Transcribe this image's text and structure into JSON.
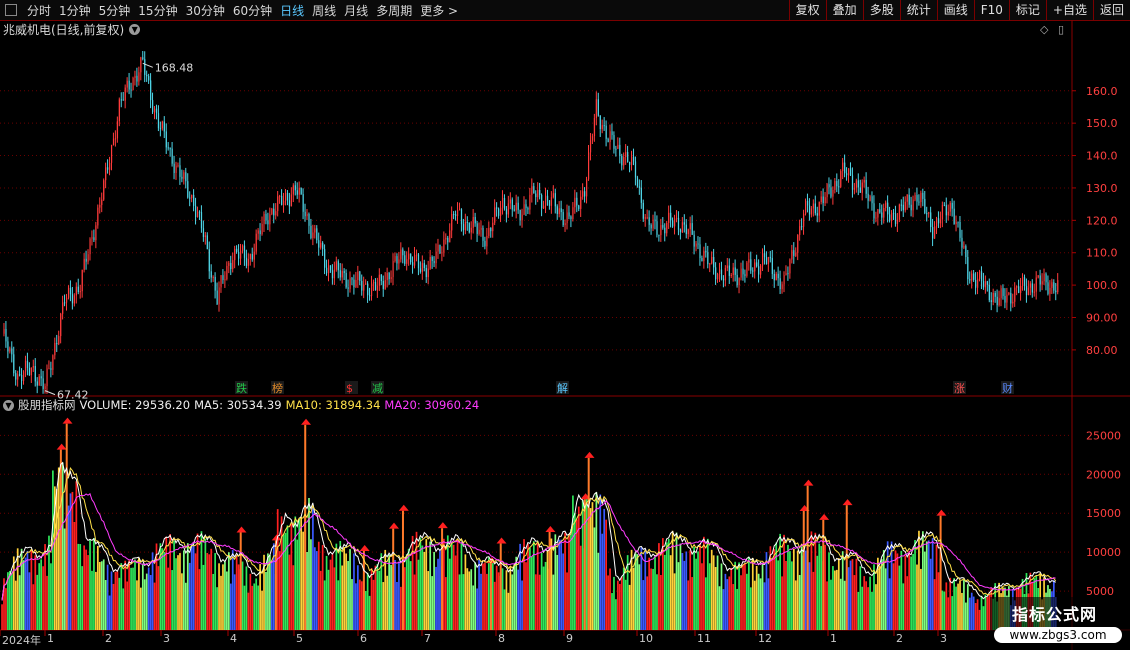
{
  "toolbar": {
    "periods": [
      "分时",
      "1分钟",
      "5分钟",
      "15分钟",
      "30分钟",
      "60分钟",
      "日线",
      "周线",
      "月线",
      "多周期",
      "更多 >"
    ],
    "active_period": "日线",
    "right_buttons": [
      "复权",
      "叠加",
      "多股",
      "统计",
      "画线",
      "F10",
      "标记",
      "+自选",
      "返回"
    ]
  },
  "title": "兆威机电(日线,前复权)",
  "price_high_label": "168.48",
  "price_low_label": "67.42",
  "price_axis": [
    "160.0",
    "150.0",
    "140.0",
    "130.0",
    "120.0",
    "110.0",
    "100.0",
    "90.00",
    "80.00"
  ],
  "volume_axis": [
    "25000",
    "20000",
    "15000",
    "10000",
    "5000"
  ],
  "events": [
    {
      "label": "跌",
      "color": "#23c84a"
    },
    {
      "label": "榜",
      "color": "#e08a2a"
    },
    {
      "label": "$",
      "color": "#ff3030"
    },
    {
      "label": "减",
      "color": "#23c84a"
    },
    {
      "label": "解",
      "color": "#5ac8ff"
    },
    {
      "label": "涨",
      "color": "#ff5050"
    },
    {
      "label": "财",
      "color": "#5a8aff"
    }
  ],
  "volume_legend": {
    "name": "股朋指标网",
    "volume": "VOLUME: 29536.20",
    "ma5": "MA5: 30534.39",
    "ma10": "MA10: 31894.34",
    "ma20": "MA20: 30960.24"
  },
  "colors": {
    "up": "#ff3b3b",
    "down": "#4fd6e8",
    "ma5": "#ffffff",
    "ma10": "#ffe14a",
    "ma20": "#ff3cff",
    "grid": "#6a0000",
    "accent": "#5ac8ff"
  },
  "x_axis": [
    "2024年",
    "1",
    "2",
    "3",
    "4",
    "5",
    "6",
    "7",
    "8",
    "9",
    "10",
    "11",
    "12",
    "1",
    "2",
    "3"
  ],
  "watermark": {
    "title": "指标公式网",
    "url": "www.zbgs3.com"
  },
  "chart_data": {
    "type": "candlestick+bar",
    "price": {
      "ylim": [
        67,
        172
      ],
      "high": 168.48,
      "low": 67.42,
      "keypoints": [
        [
          0,
          85
        ],
        [
          8,
          72
        ],
        [
          16,
          74
        ],
        [
          22,
          68
        ],
        [
          32,
          95
        ],
        [
          40,
          100
        ],
        [
          52,
          130
        ],
        [
          60,
          155
        ],
        [
          66,
          163
        ],
        [
          72,
          168
        ],
        [
          80,
          150
        ],
        [
          90,
          135
        ],
        [
          98,
          126
        ],
        [
          104,
          113
        ],
        [
          110,
          96
        ],
        [
          118,
          110
        ],
        [
          126,
          108
        ],
        [
          136,
          122
        ],
        [
          144,
          126
        ],
        [
          150,
          130
        ],
        [
          158,
          118
        ],
        [
          166,
          106
        ],
        [
          176,
          102
        ],
        [
          184,
          100
        ],
        [
          192,
          99
        ],
        [
          198,
          104
        ],
        [
          206,
          110
        ],
        [
          214,
          105
        ],
        [
          222,
          108
        ],
        [
          232,
          122
        ],
        [
          240,
          118
        ],
        [
          248,
          115
        ],
        [
          256,
          126
        ],
        [
          264,
          122
        ],
        [
          272,
          128
        ],
        [
          280,
          126
        ],
        [
          290,
          120
        ],
        [
          298,
          130
        ],
        [
          304,
          155
        ],
        [
          310,
          145
        ],
        [
          318,
          140
        ],
        [
          324,
          135
        ],
        [
          330,
          118
        ],
        [
          338,
          118
        ],
        [
          346,
          120
        ],
        [
          354,
          114
        ],
        [
          362,
          106
        ],
        [
          370,
          103
        ],
        [
          380,
          104
        ],
        [
          390,
          108
        ],
        [
          400,
          100
        ],
        [
          410,
          122
        ],
        [
          420,
          126
        ],
        [
          430,
          135
        ],
        [
          440,
          130
        ],
        [
          448,
          122
        ],
        [
          458,
          122
        ],
        [
          468,
          128
        ],
        [
          476,
          118
        ],
        [
          486,
          125
        ],
        [
          494,
          104
        ],
        [
          502,
          100
        ],
        [
          510,
          95
        ],
        [
          518,
          98
        ],
        [
          526,
          100
        ],
        [
          534,
          101
        ],
        [
          540,
          99
        ]
      ]
    },
    "volume": {
      "ylim": [
        0,
        28000
      ],
      "last": 29536.2,
      "ma5": 30534.39,
      "ma10": 31894.34,
      "ma20": 30960.24
    }
  }
}
